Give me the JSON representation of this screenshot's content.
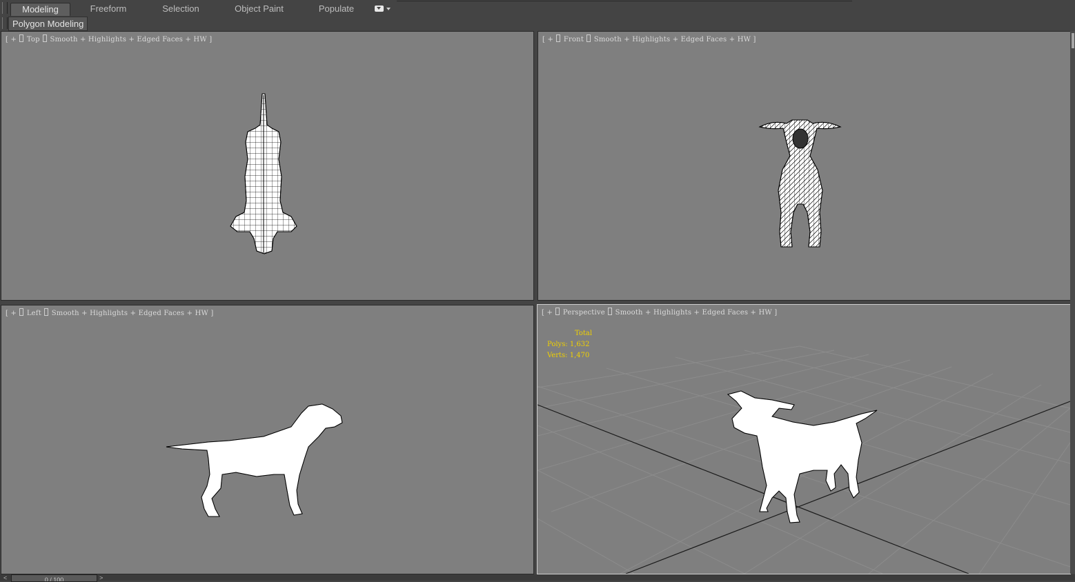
{
  "ribbon": {
    "tabs": [
      {
        "label": "Modeling",
        "active": true
      },
      {
        "label": "Freeform",
        "active": false
      },
      {
        "label": "Selection",
        "active": false
      },
      {
        "label": "Object Paint",
        "active": false
      },
      {
        "label": "Populate",
        "active": false
      }
    ],
    "options_icon": "ribbon-options-icon"
  },
  "panel": {
    "label": "Polygon Modeling"
  },
  "viewports": {
    "top": {
      "view": "Top",
      "rest": "Smooth + Highlights + Edged Faces + HW ]"
    },
    "front": {
      "view": "Front",
      "rest": "Smooth + Highlights + Edged Faces + HW ]"
    },
    "left": {
      "view": "Left",
      "rest": "Smooth + Highlights + Edged Faces + HW ]"
    },
    "persp": {
      "view": "Perspective",
      "rest": "Smooth + Highlights + Edged Faces + HW ]"
    }
  },
  "stats": {
    "title": "Total",
    "polys": "Polys: 1,632",
    "verts": "Verts: 1,470"
  },
  "timeline": {
    "value": "0 / 100",
    "prev": "<",
    "next": ">"
  },
  "colors": {
    "viewport_bg": "#7f7f7f",
    "ui_bg": "#444444",
    "stats_text": "#f0d000",
    "mesh_fill": "#ffffff",
    "mesh_wire": "#000000"
  }
}
